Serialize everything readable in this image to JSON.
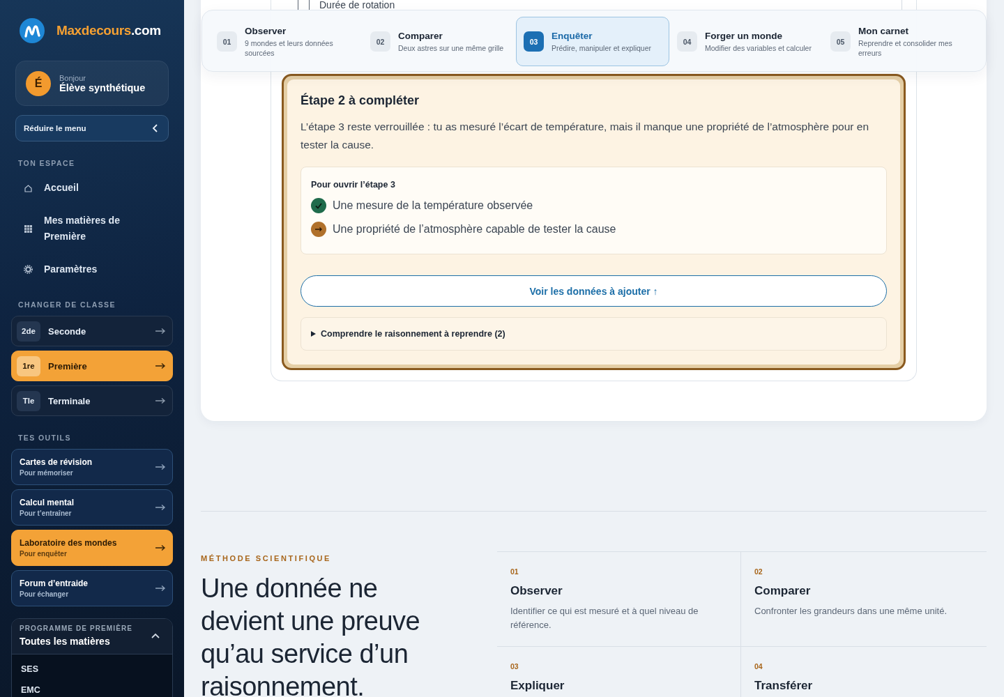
{
  "sidebar": {
    "logo": {
      "name": "Maxdecours",
      "suffix": ".com"
    },
    "user": {
      "initial": "É",
      "greeting": "Bonjour",
      "name": "Élève synthétique"
    },
    "collapse_button": "Réduire le menu",
    "space": {
      "heading": "TON ESPACE",
      "items": [
        {
          "label": "Accueil",
          "kind": "home"
        },
        {
          "label": "Mes matières de Première",
          "kind": "grid"
        },
        {
          "label": "Paramètres",
          "kind": "gear"
        }
      ]
    },
    "classes": {
      "heading": "CHANGER DE CLASSE",
      "items": [
        {
          "badge": "2de",
          "label": "Seconde",
          "selected": false
        },
        {
          "badge": "1re",
          "label": "Première",
          "selected": true
        },
        {
          "badge": "Tle",
          "label": "Terminale",
          "selected": false
        }
      ]
    },
    "tools": {
      "heading": "TES OUTILS",
      "items": [
        {
          "title": "Cartes de révision",
          "subtitle": "Pour mémoriser",
          "selected": false
        },
        {
          "title": "Calcul mental",
          "subtitle": "Pour t’entraîner",
          "selected": false
        },
        {
          "title": "Laboratoire des mondes",
          "subtitle": "Pour enquêter",
          "selected": true
        },
        {
          "title": "Forum d’entraide",
          "subtitle": "Pour échanger",
          "selected": false
        }
      ]
    },
    "programme": {
      "eyebrow": "PROGRAMME DE PREMIÈRE",
      "title": "Toutes les matières",
      "expanded": true,
      "items": [
        "SES",
        "EMC"
      ]
    }
  },
  "steps": [
    {
      "num": "01",
      "title": "Observer",
      "desc": "9 mondes et leurs données sourcées",
      "selected": false
    },
    {
      "num": "02",
      "title": "Comparer",
      "desc": "Deux astres sur une même grille",
      "selected": false
    },
    {
      "num": "03",
      "title": "Enquêter",
      "desc": "Prédire, manipuler et expliquer",
      "selected": true
    },
    {
      "num": "04",
      "title": "Forger un monde",
      "desc": "Modifier des variables et calculer",
      "selected": false
    },
    {
      "num": "05",
      "title": "Mon carnet",
      "desc": "Reprendre et consolider mes erreurs",
      "selected": false
    }
  ],
  "data_row": {
    "label": "Durée de rotation"
  },
  "alert": {
    "title": "Étape 2 à compléter",
    "text": "L’étape 3 reste verrouillée : tu as mesuré l’écart de température, mais il manque une propriété de l’atmosphère pour en tester la cause.",
    "requirements": {
      "heading": "Pour ouvrir l’étape 3",
      "items": [
        {
          "text": "Une mesure de la température observée",
          "kind": "done"
        },
        {
          "text": "Une propriété de l’atmosphère capable de tester la cause",
          "kind": "pending"
        }
      ]
    },
    "button": "Voir les données à ajouter ↑",
    "details": {
      "label": "Comprendre le raisonnement à reprendre (2)",
      "expanded": false
    }
  },
  "method": {
    "eyebrow": "MÉTHODE SCIENTIFIQUE",
    "heading": "Une donnée ne devient une preuve qu’au service d’un raisonnement.",
    "cards": [
      {
        "num": "01",
        "title": "Observer",
        "desc": "Identifier ce qui est mesuré et à quel niveau de référence."
      },
      {
        "num": "02",
        "title": "Comparer",
        "desc": "Confronter les grandeurs dans une même unité."
      },
      {
        "num": "03",
        "title": "Expliquer"
      },
      {
        "num": "04",
        "title": "Transférer"
      }
    ]
  }
}
